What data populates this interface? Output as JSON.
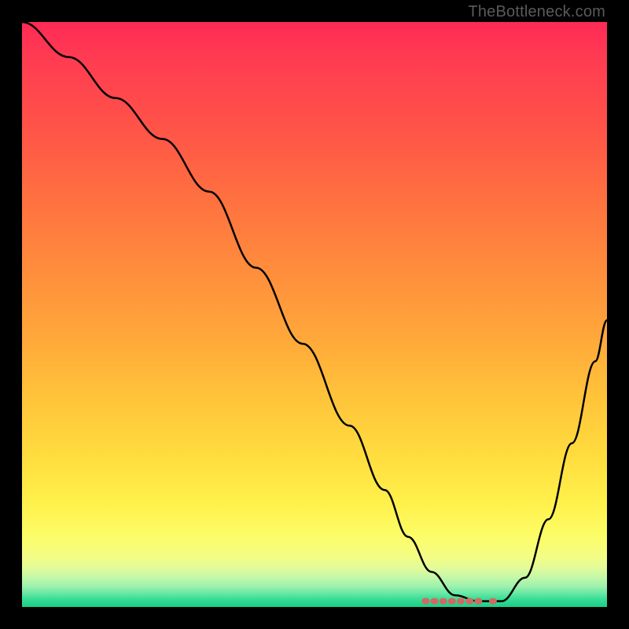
{
  "watermark": {
    "text": "TheBottleneck.com"
  },
  "chart_data": {
    "type": "line",
    "title": "",
    "xlabel": "",
    "ylabel": "",
    "xlim": [
      0,
      100
    ],
    "ylim": [
      0,
      100
    ],
    "series": [
      {
        "name": "bottleneck-curve",
        "x": [
          0,
          8,
          16,
          24,
          32,
          40,
          48,
          56,
          62,
          66,
          70,
          74,
          78,
          82,
          86,
          90,
          94,
          98,
          100
        ],
        "values": [
          100,
          94,
          87,
          80,
          71,
          58,
          45,
          31,
          20,
          12,
          6,
          2,
          1,
          1,
          5,
          15,
          28,
          42,
          49
        ]
      }
    ],
    "markers": {
      "name": "optimal-range",
      "color": "#cf6a64",
      "points": [
        {
          "x": 69.0,
          "y": 1.0
        },
        {
          "x": 70.5,
          "y": 1.0
        },
        {
          "x": 72.0,
          "y": 1.0
        },
        {
          "x": 73.5,
          "y": 1.0
        },
        {
          "x": 75.0,
          "y": 1.0
        },
        {
          "x": 76.5,
          "y": 1.0
        },
        {
          "x": 78.0,
          "y": 1.0
        },
        {
          "x": 80.5,
          "y": 1.0
        }
      ]
    },
    "background": {
      "type": "vertical-gradient",
      "stops": [
        {
          "pos": 0.0,
          "color": "#ff2a55"
        },
        {
          "pos": 0.5,
          "color": "#ffb43a"
        },
        {
          "pos": 0.85,
          "color": "#fff566"
        },
        {
          "pos": 1.0,
          "color": "#16cf87"
        }
      ]
    }
  }
}
